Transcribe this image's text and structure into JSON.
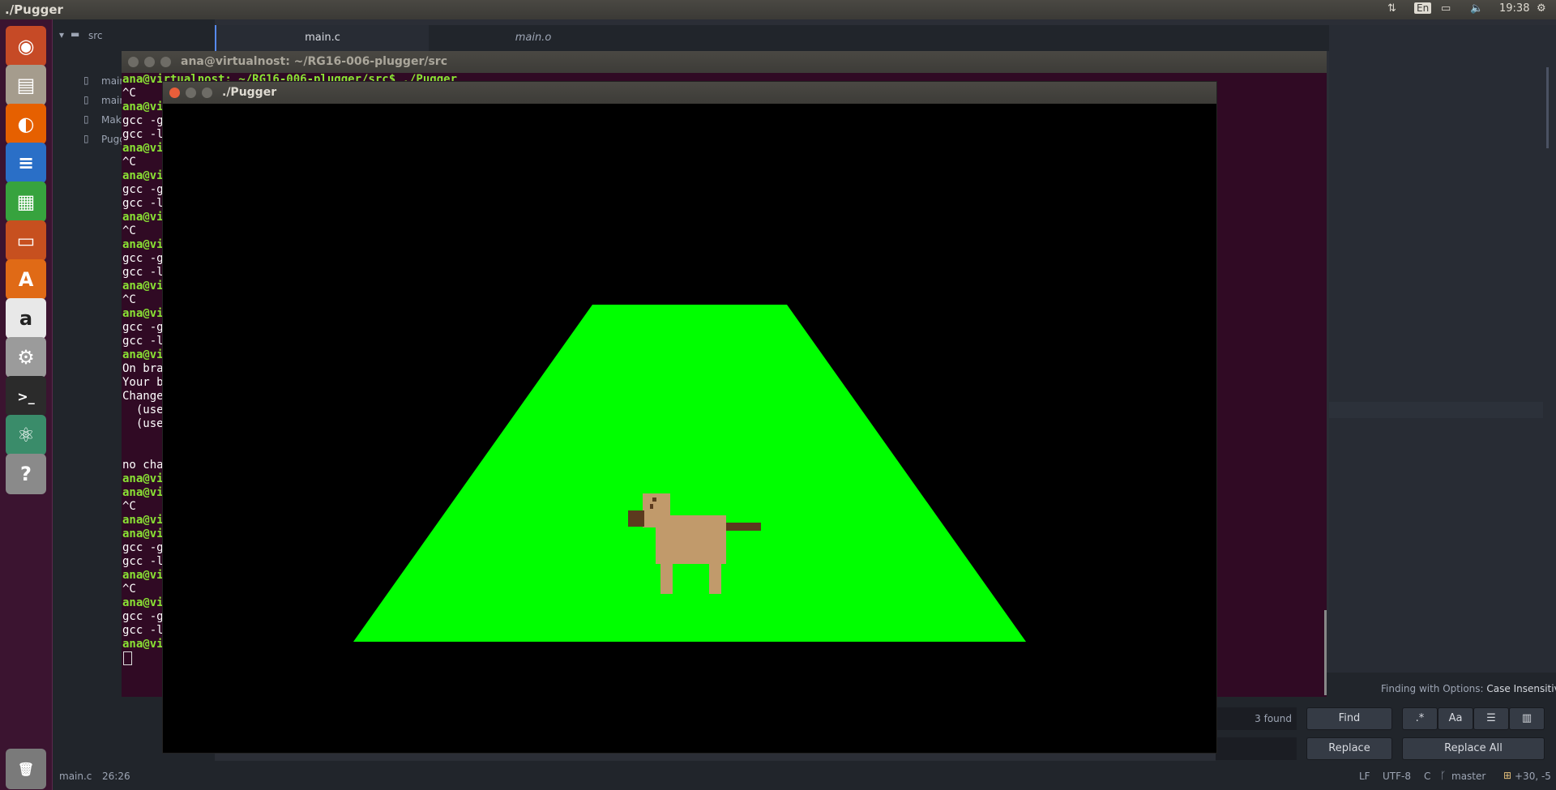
{
  "top_panel": {
    "window_title": "./Pugger",
    "keyboard_layout": "En",
    "time": "19:38",
    "icons": [
      "network-icon",
      "keyboard-icon",
      "battery-icon",
      "volume-icon",
      "settings-gear-icon"
    ]
  },
  "launcher": {
    "items": [
      {
        "name": "ubuntu-dash-icon",
        "color": "#c64a26",
        "glyph": "◉"
      },
      {
        "name": "files-icon",
        "color": "#a59c8d",
        "glyph": "▤"
      },
      {
        "name": "firefox-icon",
        "color": "#e66000",
        "glyph": "◐"
      },
      {
        "name": "writer-icon",
        "color": "#2a6fc7",
        "glyph": "≡"
      },
      {
        "name": "calc-icon",
        "color": "#37a33e",
        "glyph": "▦"
      },
      {
        "name": "impress-icon",
        "color": "#c7501f",
        "glyph": "▭"
      },
      {
        "name": "software-center-icon",
        "color": "#e06a16",
        "glyph": "A"
      },
      {
        "name": "amazon-icon",
        "color": "#e8e8e8",
        "glyph": "a"
      },
      {
        "name": "system-settings-icon",
        "color": "#9b9b9b",
        "glyph": "⚙"
      },
      {
        "name": "terminal-icon",
        "color": "#2b2b2b",
        "glyph": ">_"
      },
      {
        "name": "atom-icon",
        "color": "#3a8c6a",
        "glyph": "⚛"
      },
      {
        "name": "help-icon",
        "color": "#8a8a8a",
        "glyph": "?"
      },
      {
        "name": "trash-icon",
        "color": "#7a7a7a",
        "glyph": "🗑"
      }
    ]
  },
  "editor": {
    "tree": {
      "folder": "src",
      "files": [
        "main.c",
        "main.o",
        "Makefile",
        "Pugger"
      ]
    },
    "tabs": [
      "main.c",
      "main.o"
    ],
    "find": {
      "status": "3 found",
      "options_label": "Finding with Options:",
      "options_value": "Case Insensitive",
      "find_button": "Find",
      "replace_button": "Replace",
      "replace_all_button": "Replace All",
      "regex_label": ".*",
      "case_label": "Aa"
    },
    "status": {
      "file": "main.c",
      "cursor": "26:26",
      "line_ending": "LF",
      "encoding": "UTF-8",
      "grammar": "C",
      "branch": "master",
      "diff": "+30, -5"
    }
  },
  "terminal": {
    "title": "ana@virtualnost: ~/RG16-006-plugger/src",
    "lines": [
      {
        "text": "ana@virtualnost: ~/RG16-006-plugger/src$ ./Pugger",
        "prompt": true
      },
      {
        "text": "^C",
        "prompt": false
      },
      {
        "text": "ana@vi",
        "prompt": true
      },
      {
        "text": "gcc -g",
        "prompt": false
      },
      {
        "text": "gcc -l",
        "prompt": false
      },
      {
        "text": "ana@vi",
        "prompt": true
      },
      {
        "text": "^C",
        "prompt": false
      },
      {
        "text": "ana@vi",
        "prompt": true
      },
      {
        "text": "gcc -g",
        "prompt": false
      },
      {
        "text": "gcc -l",
        "prompt": false
      },
      {
        "text": "ana@vi",
        "prompt": true
      },
      {
        "text": "^C",
        "prompt": false
      },
      {
        "text": "ana@vi",
        "prompt": true
      },
      {
        "text": "gcc -g",
        "prompt": false
      },
      {
        "text": "gcc -l",
        "prompt": false
      },
      {
        "text": "ana@vi",
        "prompt": true
      },
      {
        "text": "^C",
        "prompt": false
      },
      {
        "text": "ana@vi",
        "prompt": true
      },
      {
        "text": "gcc -g",
        "prompt": false
      },
      {
        "text": "gcc -l",
        "prompt": false
      },
      {
        "text": "ana@vi",
        "prompt": true
      },
      {
        "text": "On bra",
        "prompt": false
      },
      {
        "text": "Your b",
        "prompt": false
      },
      {
        "text": "Change",
        "prompt": false
      },
      {
        "text": "  (use",
        "prompt": false
      },
      {
        "text": "  (use",
        "prompt": false
      },
      {
        "text": "",
        "prompt": false
      },
      {
        "text": "",
        "prompt": false
      },
      {
        "text": "no cha",
        "prompt": false
      },
      {
        "text": "ana@vi",
        "prompt": true
      },
      {
        "text": "ana@vi",
        "prompt": true
      },
      {
        "text": "^C",
        "prompt": false
      },
      {
        "text": "ana@vi",
        "prompt": true
      },
      {
        "text": "ana@vi",
        "prompt": true
      },
      {
        "text": "gcc -g",
        "prompt": false
      },
      {
        "text": "gcc -l",
        "prompt": false
      },
      {
        "text": "ana@vi",
        "prompt": true
      },
      {
        "text": "^C",
        "prompt": false
      },
      {
        "text": "ana@vi",
        "prompt": true
      },
      {
        "text": "gcc -g",
        "prompt": false
      },
      {
        "text": "gcc -l",
        "prompt": false
      },
      {
        "text": "ana@vi",
        "prompt": true
      }
    ]
  },
  "pugger": {
    "title": "./Pugger",
    "scene": {
      "ground_color": "#00ff00",
      "dog_body_color": "#c19a6b",
      "dog_dark_color": "#5c3a1e"
    }
  }
}
